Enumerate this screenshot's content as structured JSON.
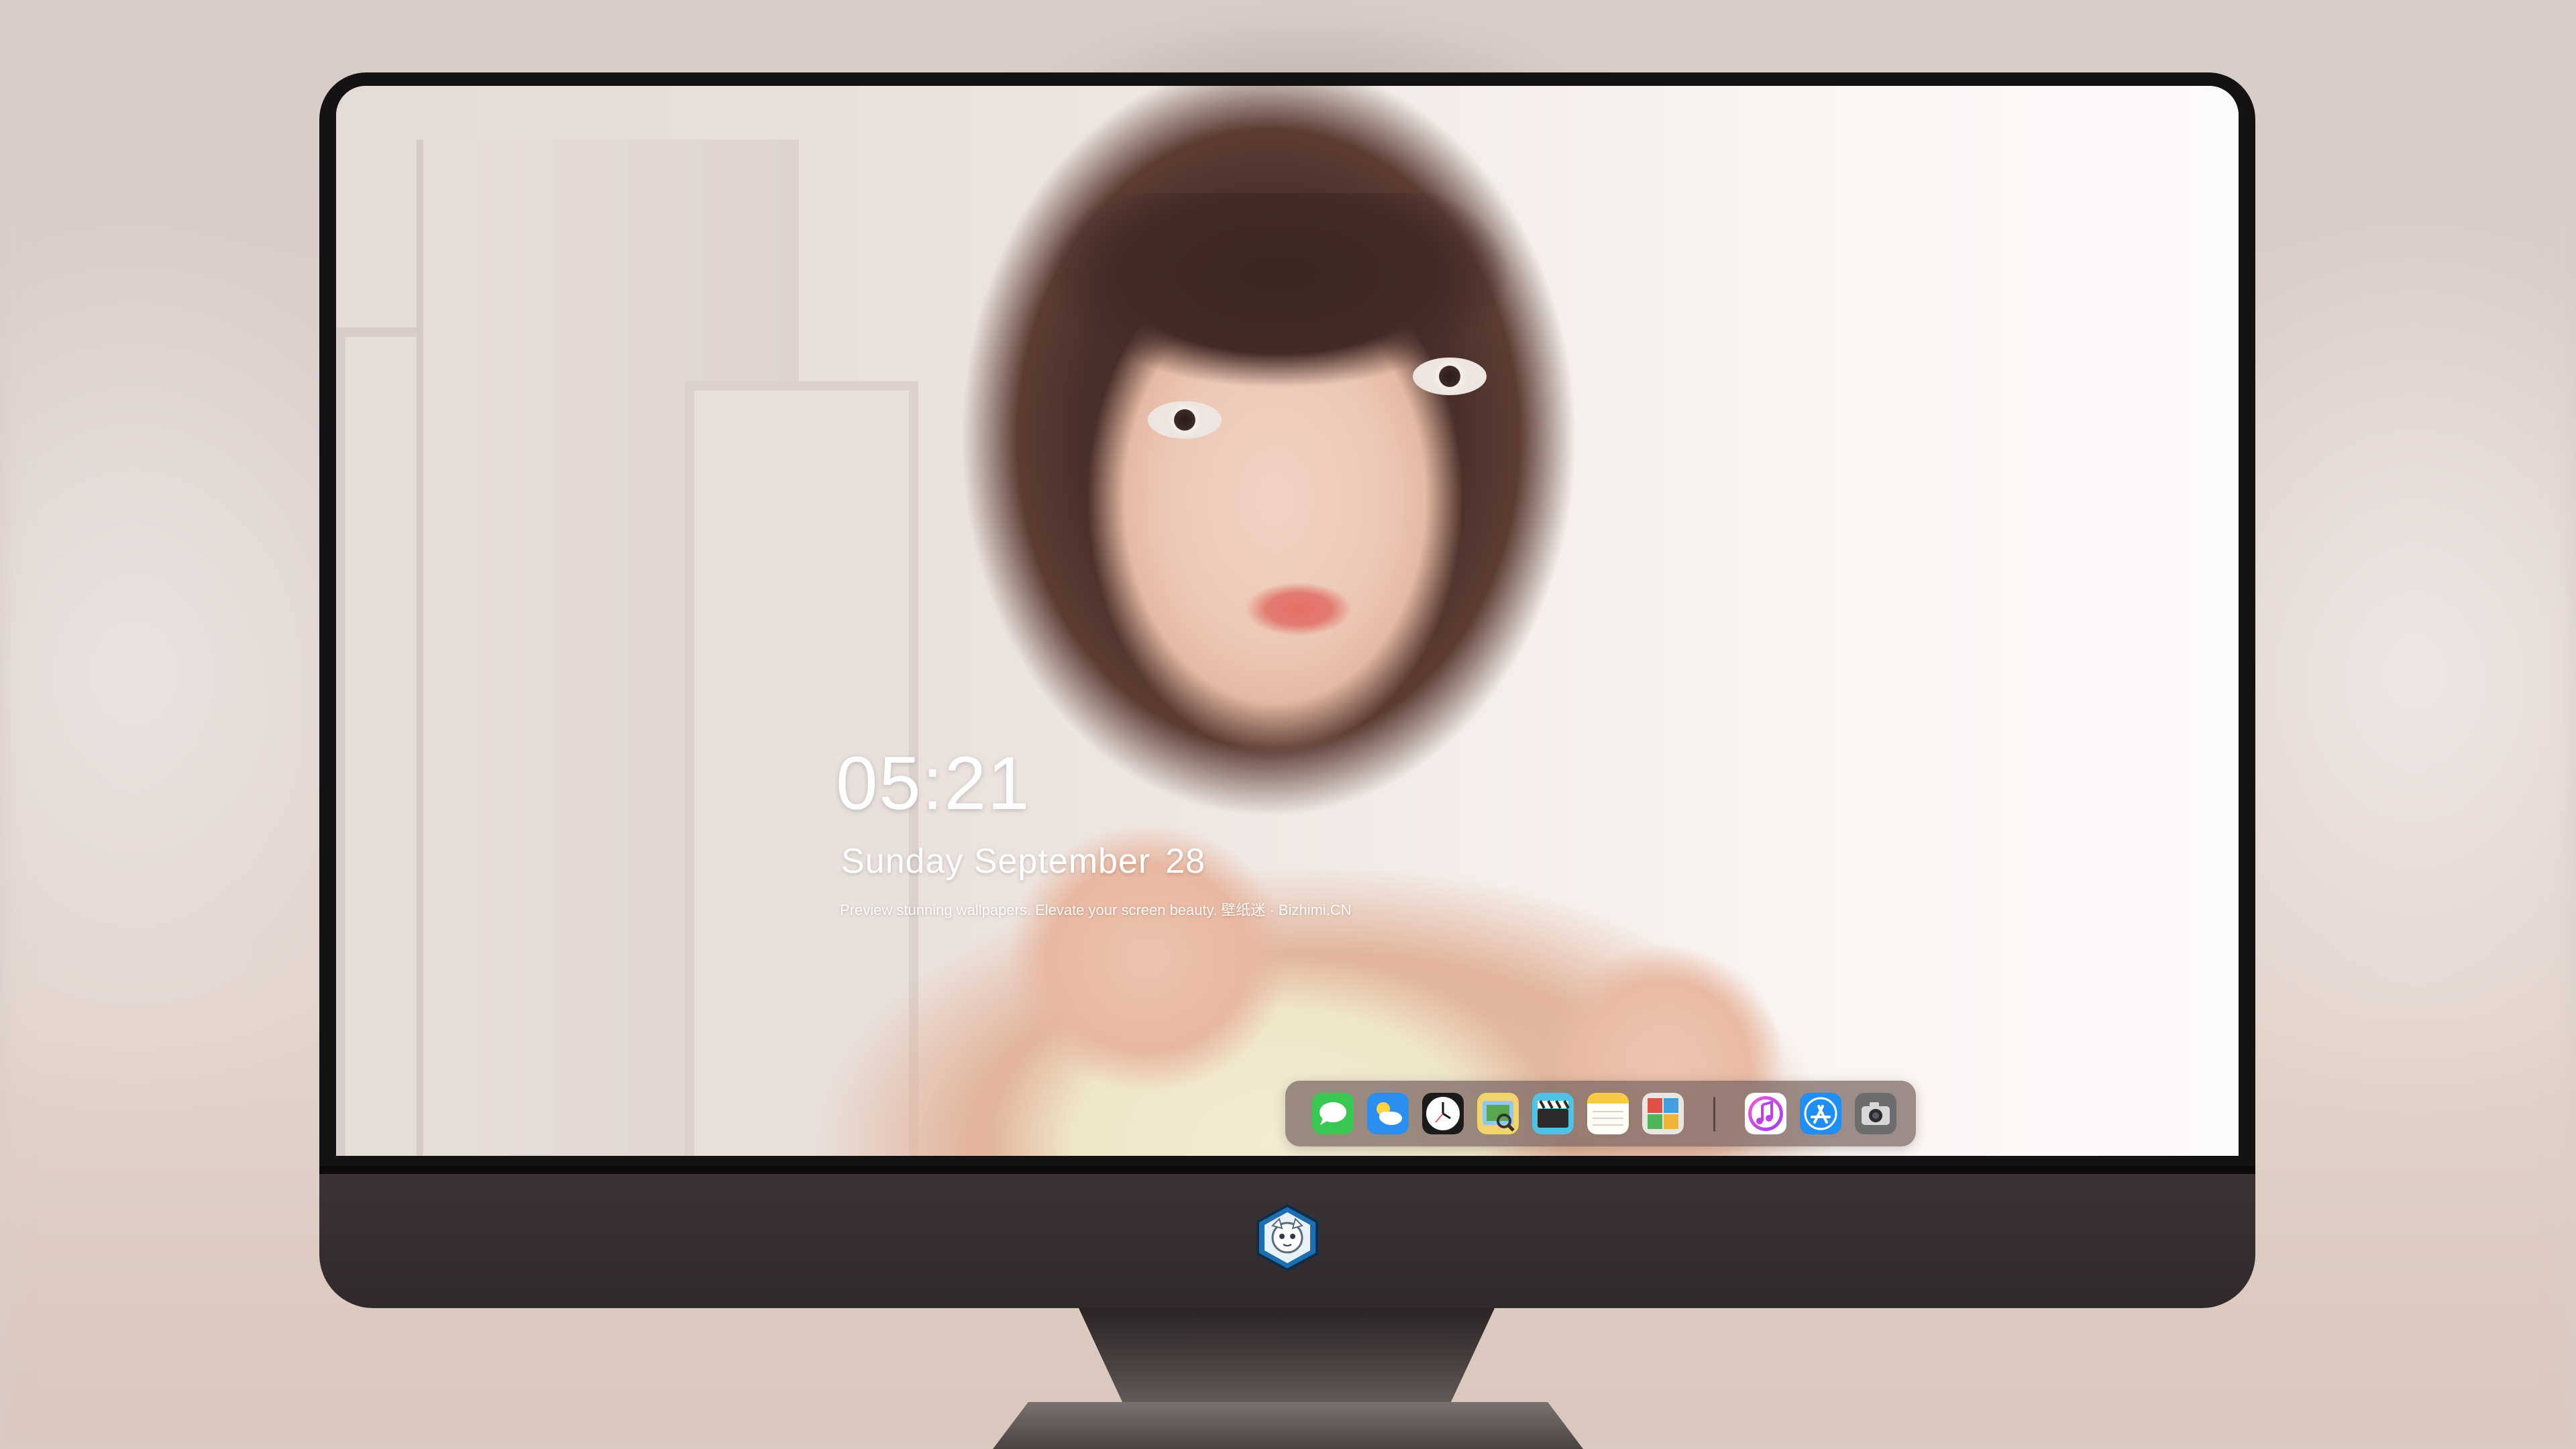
{
  "lock_screen": {
    "time": "05:21",
    "day": "Sunday",
    "month": "September",
    "date_num": "28",
    "tagline": "Preview stunning wallpapers. Elevate your screen beauty. 壁纸迷 · Bizhimi.CN"
  },
  "dock": {
    "apps": [
      {
        "name": "Messages",
        "icon": "messages-icon"
      },
      {
        "name": "Weather",
        "icon": "weather-icon"
      },
      {
        "name": "Clock",
        "icon": "clock-icon"
      },
      {
        "name": "Preview",
        "icon": "preview-icon"
      },
      {
        "name": "Clips",
        "icon": "clapper-icon"
      },
      {
        "name": "Notes",
        "icon": "notes-icon"
      },
      {
        "name": "Photo Booth",
        "icon": "photo-booth-icon"
      },
      {
        "name": "iTunes",
        "icon": "itunes-icon"
      },
      {
        "name": "App Store",
        "icon": "app-store-icon"
      },
      {
        "name": "Camera",
        "icon": "camera-icon"
      }
    ]
  },
  "colors": {
    "bezel": "#151214",
    "chin": "#3b3336",
    "dock_bg": "#78645f",
    "text": "#ffffff"
  }
}
